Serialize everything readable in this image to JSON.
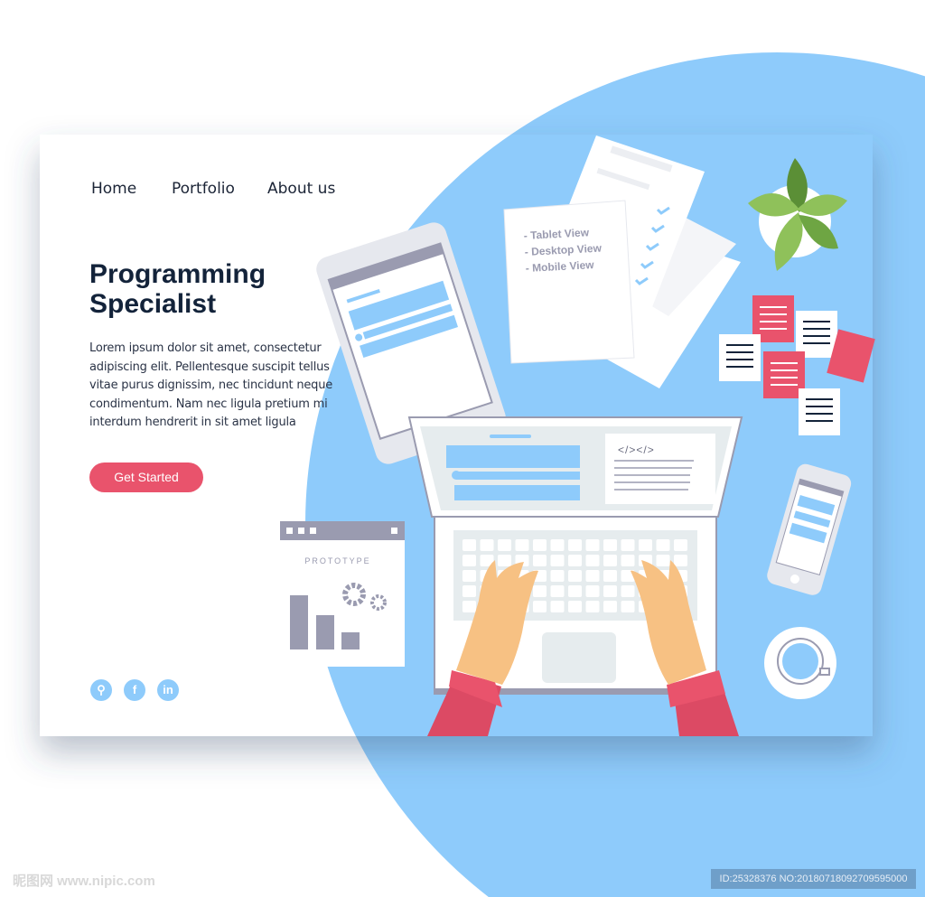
{
  "nav": {
    "items": [
      {
        "label": "Home"
      },
      {
        "label": "Portfolio"
      },
      {
        "label": "About us"
      }
    ]
  },
  "hero": {
    "title": "Programming Specialist",
    "body": "Lorem ipsum dolor sit amet, consectetur adipiscing elit. Pellentesque suscipit tellus vitae purus dignissim, nec tincidunt neque condimentum. Nam nec ligula pretium mi interdum hendrerit in sit amet ligula",
    "cta_label": "Get Started"
  },
  "social": [
    {
      "icon": "location-pin-icon",
      "glyph": "⚲"
    },
    {
      "icon": "facebook-icon",
      "glyph": "f"
    },
    {
      "icon": "linkedin-icon",
      "glyph": "in"
    }
  ],
  "illustration": {
    "document_list": [
      "- Tablet View",
      "- Desktop View",
      "- Mobile View"
    ],
    "code_tag": "</></>",
    "prototype_label": "PROTOTYPE"
  },
  "watermark": {
    "left": "昵图网 www.nipic.com",
    "right": "ID:25328376 NO:20180718092709595000"
  },
  "colors": {
    "accent": "#e9536c",
    "blue": "#8ecbfb",
    "navy": "#13233a",
    "gray": "#9a9bb0"
  }
}
